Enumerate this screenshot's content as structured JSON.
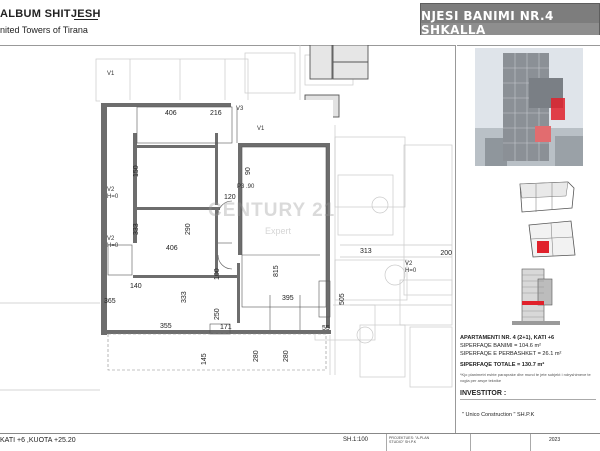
{
  "header": {
    "album_title": "ALBUM SHITJESH",
    "company": "nited   Towers of Tirana",
    "unit_title": "NJESI BANIMI NR.4 SHKALLA"
  },
  "plan": {
    "dimensions": {
      "d406_top": "406",
      "d216": "216",
      "d150": "150",
      "d90": "90",
      "d120": "120",
      "d333_a": "333",
      "d290": "290",
      "d406_mid": "406",
      "d815": "815",
      "d395": "395",
      "d100": "100",
      "d140": "140",
      "d333_b": "333",
      "d250": "250",
      "d171": "171",
      "d355": "355",
      "d280_a": "280",
      "d280_b": "280",
      "d55": "55",
      "d145": "145",
      "d313": "313",
      "d505": "505",
      "d365": "365",
      "d200": "200"
    },
    "labels": {
      "v1": "V1",
      "h0_a": "H=0",
      "v2_a": "V2",
      "h0_b": "H=0",
      "v2_b": "V2",
      "v3": "V3",
      "v1b": "V1",
      "p3": "P3 .90",
      "v2_c": "V2",
      "h0_c": "H=0"
    }
  },
  "watermark": {
    "brand": "CENTURY 21",
    "sub": "Expert"
  },
  "info": {
    "apartment": "APARTAMENTI NR. 4 (2+1), KATI +6",
    "living_area": "SIPERFAQE BANIMI = 104.6 m²",
    "shared_area": "SIPERFAQE E PERBASHKET = 26.1 m²",
    "total_area": "SIPERFAQE TOTALE = 130.7 m²",
    "note": "*Kjo planimetri eshte paraprake dhe mund te jete subjekt i ndryshimeve te vogla per arsye teknike",
    "investor_label": "INVESTITOR :",
    "investor_name": "\" Unico Construction \" SH.P.K"
  },
  "footer": {
    "level": "KATI +6 ,KUOTA +25.20",
    "scale": "SH.1:100",
    "project_label": "PROJEKTUES:",
    "project_name": "\"A-PLAN STUDIO\" SH.P.K",
    "year": "2023"
  },
  "colors": {
    "header_bg": "#7d7d7d",
    "highlight": "#e0212b",
    "wall": "#6d6d6d"
  }
}
